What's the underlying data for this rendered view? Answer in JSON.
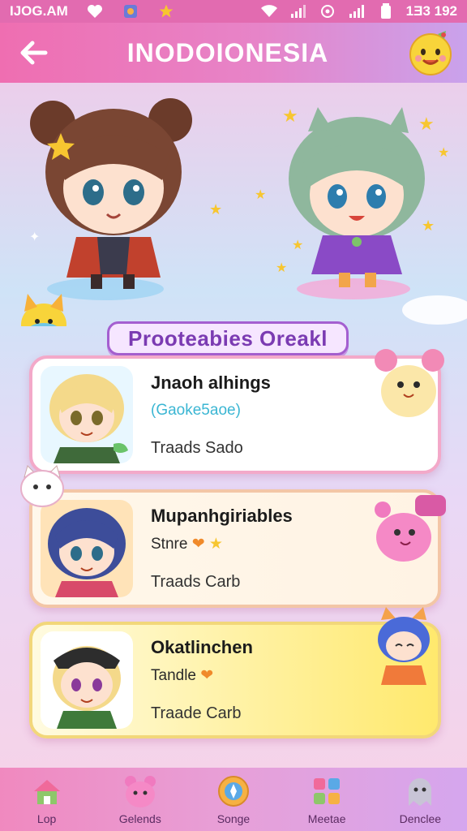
{
  "status_bar": {
    "left_text": "IJOG.AM",
    "right_text": "1Ǝ3 192",
    "icons": [
      "heart-icon",
      "app-icon",
      "star-icon",
      "wifi-icon",
      "signal-icon",
      "location-icon",
      "signal-icon",
      "battery-icon"
    ]
  },
  "header": {
    "title": "INODOIONESIA",
    "back_icon": "arrow-left-icon",
    "mascot_icon": "yellow-mascot-icon"
  },
  "banner": {
    "text": "Prooteabies Oreakl"
  },
  "cards": [
    {
      "name": "Jnaoh alhings",
      "subtitle": "(Gaoke5aoe)",
      "tag": "Traads Sado"
    },
    {
      "name": "Mupanhgiriables",
      "subtitle": "Stnre",
      "tag": "Traads Carb"
    },
    {
      "name": "Okatlinchen",
      "subtitle": "Tandle",
      "tag": "Traade Carb"
    }
  ],
  "bottom_nav": [
    {
      "label": "Lop",
      "icon": "house-icon"
    },
    {
      "label": "Gelends",
      "icon": "pink-bear-icon"
    },
    {
      "label": "Songe",
      "icon": "compass-icon"
    },
    {
      "label": "Meetae",
      "icon": "grid-apps-icon"
    },
    {
      "label": "Denclee",
      "icon": "ghost-icon"
    }
  ],
  "colors": {
    "accent": "#e26bb0",
    "banner_border": "#a45fd0",
    "card_border": "#f3a9c9"
  }
}
